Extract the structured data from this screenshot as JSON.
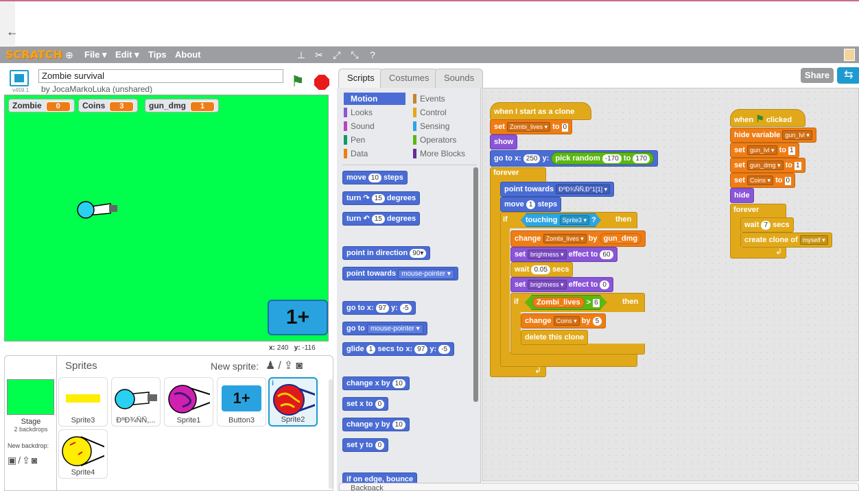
{
  "menubar": {
    "logo": "SCRATCH",
    "items": [
      "File ▾",
      "Edit ▾",
      "Tips",
      "About"
    ]
  },
  "stage": {
    "version": "v459.1",
    "project_title": "Zombie survival",
    "author": "by JocaMarkoLuka (unshared)",
    "monitors": [
      {
        "label": "Zombie",
        "value": "0"
      },
      {
        "label": "Coins",
        "value": "3"
      },
      {
        "label": "gun_dmg",
        "value": "1"
      }
    ],
    "button_text": "1+",
    "coords": {
      "x_label": "x:",
      "x": "240",
      "y_label": "y:",
      "y": "-116"
    }
  },
  "sprites": {
    "title": "Sprites",
    "new_sprite": "New sprite:",
    "stage_label": "Stage",
    "stage_backdrops": "2 backdrops",
    "new_backdrop": "New backdrop:",
    "items": [
      {
        "name": "Sprite3"
      },
      {
        "name": "ÐºÐ¾ÑÑ,..."
      },
      {
        "name": "Sprite1"
      },
      {
        "name": "Button3"
      },
      {
        "name": "Sprite2"
      },
      {
        "name": "Sprite4"
      }
    ]
  },
  "tabs": [
    "Scripts",
    "Costumes",
    "Sounds"
  ],
  "share_label": "Share",
  "categories": [
    {
      "label": "Motion",
      "color": "#4a6cd4"
    },
    {
      "label": "Looks",
      "color": "#8a55d7"
    },
    {
      "label": "Sound",
      "color": "#bb42c3"
    },
    {
      "label": "Pen",
      "color": "#0e9a6c"
    },
    {
      "label": "Data",
      "color": "#ee7d16"
    },
    {
      "label": "Events",
      "color": "#c88330"
    },
    {
      "label": "Control",
      "color": "#e1a91a"
    },
    {
      "label": "Sensing",
      "color": "#2ca5e2"
    },
    {
      "label": "Operators",
      "color": "#5cb712"
    },
    {
      "label": "More Blocks",
      "color": "#632d99"
    }
  ],
  "palette": {
    "move": {
      "pre": "move",
      "n": "10",
      "post": "steps"
    },
    "turn_cw": {
      "pre": "turn ↷",
      "n": "15",
      "post": "degrees"
    },
    "turn_ccw": {
      "pre": "turn ↶",
      "n": "15",
      "post": "degrees"
    },
    "point_dir": {
      "pre": "point in direction",
      "n": "90▾"
    },
    "point_towards": {
      "pre": "point towards",
      "dd": "mouse-pointer ▾"
    },
    "goto_xy": {
      "pre": "go to x:",
      "x": "97",
      "mid": "y:",
      "y": "-5"
    },
    "goto": {
      "pre": "go to",
      "dd": "mouse-pointer ▾"
    },
    "glide": {
      "pre": "glide",
      "n": "1",
      "mid": "secs to x:",
      "x": "97",
      "mid2": "y:",
      "y": "-5"
    },
    "change_x": {
      "pre": "change x by",
      "n": "10"
    },
    "set_x": {
      "pre": "set x to",
      "n": "0"
    },
    "change_y": {
      "pre": "change y by",
      "n": "10"
    },
    "set_y": {
      "pre": "set y to",
      "n": "0"
    },
    "bounce": {
      "pre": "if on edge, bounce"
    }
  },
  "script1": {
    "hat": "when I start as a clone",
    "set_var_pre": "set",
    "set_var_dd": "Zombi_lives ▾",
    "set_var_mid": "to",
    "set_var_val": "0",
    "show": "show",
    "goto_pre": "go to x:",
    "goto_x": "250",
    "goto_mid": "y:",
    "rnd_pre": "pick random",
    "rnd_a": "-170",
    "rnd_mid": "to",
    "rnd_b": "170",
    "forever": "forever",
    "point_pre": "point towards",
    "point_dd": "ÐºÐ¾ÑÑ‚Ð°1[1] ▾",
    "move_pre": "move",
    "move_n": "1",
    "move_post": "steps",
    "if1": "if",
    "touch_pre": "touching",
    "touch_dd": "Sprite3 ▾",
    "touch_q": "?",
    "then": "then",
    "change_pre": "change",
    "change_dd": "Zombi_lives ▾",
    "change_mid": "by",
    "change_rep": "gun_dmg",
    "bright1_pre": "set",
    "bright1_dd": "brightness ▾",
    "bright1_mid": "effect to",
    "bright1_val": "60",
    "wait_pre": "wait",
    "wait_n": "0.05",
    "wait_post": "secs",
    "bright2_pre": "set",
    "bright2_dd": "brightness ▾",
    "bright2_mid": "effect to",
    "bright2_val": "0",
    "if2": "if",
    "gt_rep": "Zombi_lives",
    "gt_op": ">",
    "gt_val": "6",
    "then2": "then",
    "coins_pre": "change",
    "coins_dd": "Coins ▾",
    "coins_mid": "by",
    "coins_val": "5",
    "delete": "delete this clone"
  },
  "script2": {
    "hat_pre": "when",
    "hat_post": "clicked",
    "hide_var_pre": "hide variable",
    "hide_var_dd": "gun_lvl ▾",
    "s1_pre": "set",
    "s1_dd": "gun_lvl ▾",
    "s1_mid": "to",
    "s1_val": "1",
    "s2_pre": "set",
    "s2_dd": "gun_dmg ▾",
    "s2_mid": "to",
    "s2_val": "1",
    "s3_pre": "set",
    "s3_dd": "Coins ▾",
    "s3_mid": "to",
    "s3_val": "0",
    "hide": "hide",
    "forever": "forever",
    "wait_pre": "wait",
    "wait_n": "7",
    "wait_post": "secs",
    "clone_pre": "create clone of",
    "clone_dd": "myself ▾"
  },
  "backpack": "Backpack"
}
